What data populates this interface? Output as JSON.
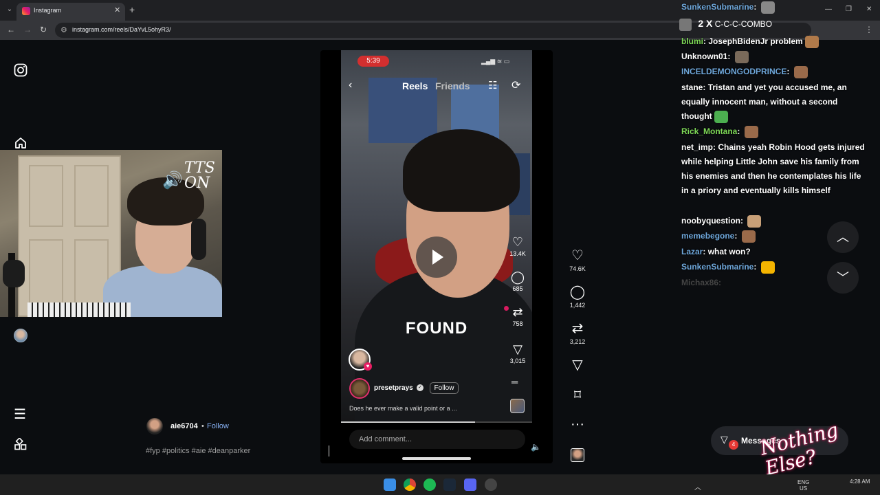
{
  "browser": {
    "tab_title": "Instagram",
    "url": "instagram.com/reels/DaYvL5ohyR3/"
  },
  "webcam": {
    "overlay_text": "TTS ON"
  },
  "reel": {
    "status_time": "5:39",
    "tabs": [
      "Reels",
      "Friends"
    ],
    "overlay_caption": "FOUND",
    "inner_actions": {
      "likes": "13.4K",
      "comments": "685",
      "reposts": "758",
      "shares": "3,015"
    },
    "poster_name": "presetprays",
    "follow_label": "Follow",
    "caption": "Does he ever make a valid point or a ...",
    "add_comment_placeholder": "Add comment...",
    "progress": 0.7
  },
  "outer_actions": {
    "likes": "74.6K",
    "comments": "1,442",
    "reposts": "3,212"
  },
  "post": {
    "username": "aie6704",
    "separator": "•",
    "follow_label": "Follow",
    "hashtags": "#fyp #politics #aie #deanparker"
  },
  "chat": {
    "combo_prefix": "2 X",
    "combo_text": "C-C-C-COMBO",
    "fade_line": "Michax86:",
    "messages": [
      {
        "user": "SunkenSubmarine",
        "text": "",
        "color": "#6fa8dc"
      },
      {
        "user": "blumi",
        "text": "JosephBidenJr problem",
        "color": "#7ed957"
      },
      {
        "user": "Unknown01",
        "text": "",
        "color": "#ffffff"
      },
      {
        "user": "INCELDEMONGODPRINCE",
        "text": "",
        "color": "#6fa8dc"
      },
      {
        "user": "stane",
        "text": "Tristan and yet you accused me, an equally innocent man, without a second thought",
        "color": "#ffffff"
      },
      {
        "user": "Rick_Montana",
        "text": "",
        "color": "#7ed957"
      },
      {
        "user": "net_imp",
        "text": "Chains yeah Robin Hood gets injured while helping Little John save his family from his enemies and then he contemplates his life in a priory and eventually kills himself",
        "color": "#ffffff"
      },
      {
        "user": "noobyquestion",
        "text": "",
        "color": "#ffffff"
      },
      {
        "user": "memebegone",
        "text": "",
        "color": "#6fa8dc"
      },
      {
        "user": "Lazar",
        "text": "what won?",
        "color": "#6fa8dc"
      },
      {
        "user": "SunkenSubmarine",
        "text": "",
        "color": "#6fa8dc"
      }
    ]
  },
  "messages_pill": {
    "label": "Messages",
    "badge": "4"
  },
  "logo_text": "Nothing Else?",
  "tray": {
    "lang1": "ENG",
    "lang2": "US",
    "time": "4:28 AM"
  }
}
